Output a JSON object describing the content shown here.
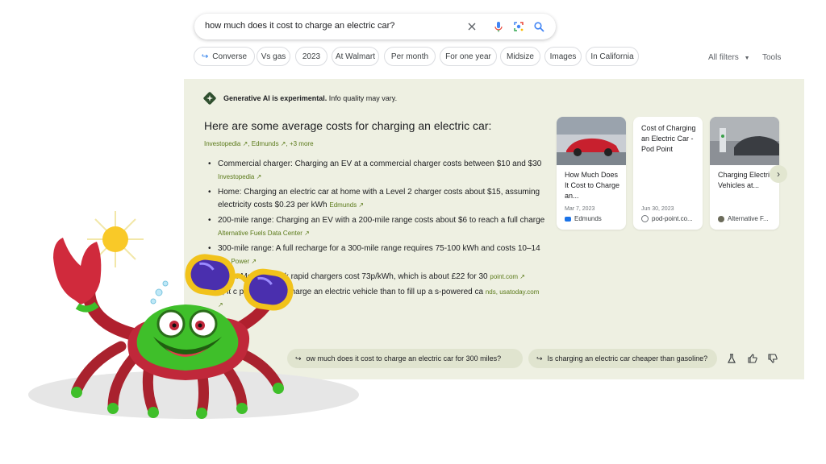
{
  "search": {
    "query": "how much does it cost to charge an electric car?",
    "icons": [
      "close-icon",
      "mic-icon",
      "lens-icon",
      "search-icon"
    ]
  },
  "chips": [
    "Converse",
    "Vs gas",
    "2023",
    "At Walmart",
    "Per month",
    "For one year",
    "Midsize",
    "Images",
    "In California"
  ],
  "tools": {
    "all_filters": "All filters",
    "tools": "Tools"
  },
  "ai": {
    "badge_bold": "Generative AI is experimental.",
    "badge_rest": " Info quality may vary.",
    "headline": "Here are some average costs for charging an electric car:",
    "headline_sources": [
      "Investopedia",
      "Edmunds",
      "+3 more"
    ],
    "bullets": [
      {
        "text": "Commercial charger: Charging an EV at a commercial charger costs between $10 and $30",
        "source": "Investopedia"
      },
      {
        "text": "Home: Charging an electric car at home with a Level 2 charger costs about $15, assuming electricity costs $0.23 per kWh",
        "source": "Edmunds"
      },
      {
        "text": "200-mile range: Charging an EV with a 200-mile range costs about $6 to reach a full charge",
        "source": "Alternative Fuels Data Center"
      },
      {
        "text": "300-mile range: A full recharge for a 300-mile range requires 75-100 kWh and costs 10–14",
        "source": "J.D. Power"
      },
      {
        "text": "rgers: Most network rapid chargers cost 73p/kWh, which is about £22 for 30",
        "source": "point.com"
      },
      {
        "text": "h, it c per month to charge an electric vehicle than to fill up a s-powered ca",
        "source": "nds, usatoday.com"
      }
    ],
    "cards": [
      {
        "title": "How Much Does It Cost to Charge an...",
        "date": "Mar 7, 2023",
        "site": "Edmunds"
      },
      {
        "title": "Cost of Charging an Electric Car - Pod Point",
        "date": "Jun 30, 2023",
        "site": "pod-point.co..."
      },
      {
        "title": "Charging Electric Vehicles at...",
        "date": "",
        "site": "Alternative F..."
      }
    ],
    "followups": [
      "ow much does it cost to charge an electric car for 300 miles?",
      "Is charging an electric car cheaper than gasoline?"
    ]
  },
  "colors": {
    "panel_bg": "#eef0e2",
    "source_green": "#5b7a1a",
    "crab_green": "#2fb51a",
    "crab_red": "#c0283a"
  }
}
